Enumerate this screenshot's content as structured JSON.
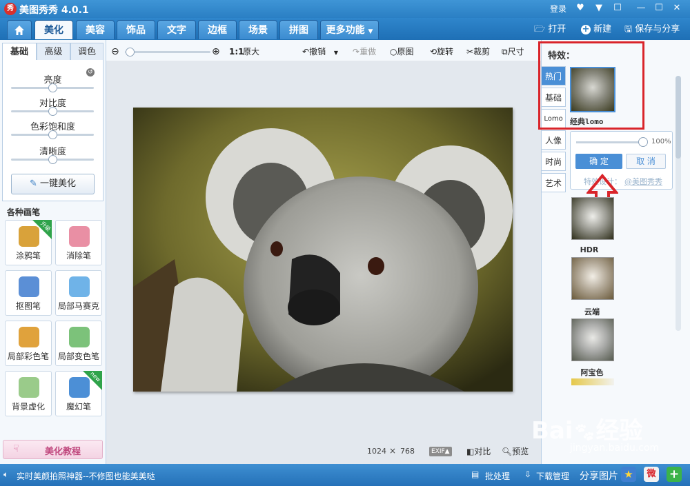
{
  "window": {
    "logo_text": "秀",
    "title": "美图秀秀 4.0.1",
    "login": "登录"
  },
  "tabs": [
    {
      "label": "美化"
    },
    {
      "label": "美容"
    },
    {
      "label": "饰品"
    },
    {
      "label": "文字"
    },
    {
      "label": "边框"
    },
    {
      "label": "场景"
    },
    {
      "label": "拼图"
    },
    {
      "label": "更多功能"
    }
  ],
  "topbar": {
    "open": "打开",
    "new": "新建",
    "save_share": "保存与分享"
  },
  "left": {
    "subtabs": [
      "基础",
      "高级",
      "调色"
    ],
    "sliders": [
      {
        "label": "亮度",
        "value": 0.5
      },
      {
        "label": "对比度",
        "value": 0.5
      },
      {
        "label": "色彩饱和度",
        "value": 0.5
      },
      {
        "label": "清晰度",
        "value": 0.5
      }
    ],
    "one_click": "一键美化",
    "brushes_title": "各种画笔",
    "brushes": [
      {
        "label": "涂鸦笔",
        "badge": "升级",
        "color": "#d9a23a"
      },
      {
        "label": "消除笔",
        "badge": "",
        "color": "#e98fa4"
      },
      {
        "label": "抠图笔",
        "badge": "",
        "color": "#5b8fd6"
      },
      {
        "label": "局部马赛克",
        "badge": "",
        "color": "#6fb3e8"
      },
      {
        "label": "局部彩色笔",
        "badge": "",
        "color": "#e0a23c"
      },
      {
        "label": "局部变色笔",
        "badge": "",
        "color": "#7cc27a"
      },
      {
        "label": "背景虚化",
        "badge": "",
        "color": "#9acb8a"
      },
      {
        "label": "魔幻笔",
        "badge": "new",
        "color": "#4c8fd6"
      }
    ],
    "tutorial": "美化教程"
  },
  "toolbar": {
    "zoom_ratio": "1:1",
    "original_size": "原大",
    "zoom_level": 0.05,
    "undo": "撤销",
    "redo": "重做",
    "original": "原图",
    "rotate": "旋转",
    "crop": "裁剪",
    "size": "尺寸"
  },
  "canvas": {
    "width": "1024",
    "times": "×",
    "height": "768",
    "exif": "EXIF▲",
    "compare": "对比",
    "preview": "预览"
  },
  "effects": {
    "title": "特效：",
    "categories": [
      "热门",
      "基础",
      "Lomo",
      "人像",
      "时尚",
      "艺术"
    ],
    "active_category": "热门",
    "selected": {
      "name": "经典lomo"
    },
    "popup": {
      "opacity_value": 1.0,
      "opacity_label": "100%",
      "confirm": "确 定",
      "cancel": "取 消",
      "designer_label": "特效设计：",
      "designer_link": "@美图秀秀"
    },
    "thumbnails": [
      {
        "name": "HDR"
      },
      {
        "name": "云端"
      },
      {
        "name": "阿宝色"
      }
    ],
    "highlight_color": "#d9242a"
  },
  "watermark": {
    "brand": "Bai",
    "brand2": "经验",
    "url": "jingyan.baidu.com"
  },
  "status": {
    "marquee": "实时美颜拍照神器--不修图也能美美哒",
    "batch": "批处理",
    "download": "下载管理",
    "share": "分享图片"
  }
}
